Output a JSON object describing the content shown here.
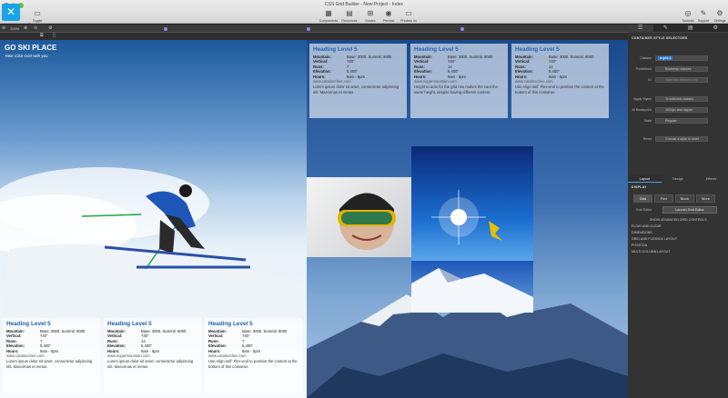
{
  "window": {
    "title": "CSS Grid Builder - New Project - Index"
  },
  "toolbar": {
    "toggle_breakpoints": "Toggle Breakpoints",
    "components": "Components",
    "resources": "Resources",
    "guides": "Guides",
    "preview": "Preview",
    "preview_on": "Preview on",
    "tutorials": "Tutorials",
    "support": "Support",
    "settings": "Settings",
    "zoom": "100%"
  },
  "breadcrumb": "Grid Box",
  "site": {
    "title": "GO SKI PLACE",
    "tagline": "Take CSS Grid with you"
  },
  "cards_top": [
    {
      "heading": "Heading Level 5",
      "rows": [
        [
          "Mountain:",
          "Base: 3000. Summit: 9000"
        ],
        [
          "Vertical:",
          "740\""
        ],
        [
          "Runs:",
          "7"
        ],
        [
          "Elevation:",
          "5,400\""
        ],
        [
          "Hours:",
          "9am - 5pm"
        ]
      ],
      "url": "www.cataloochee.com",
      "text": "Lorem ipsum dolor sit amet, consectetur adipiscing elit. Maecenas et metus."
    },
    {
      "heading": "Heading Level 5",
      "rows": [
        [
          "Mountain:",
          "Base: 3000. Summit: 9000"
        ],
        [
          "Vertical:",
          "740\""
        ],
        [
          "Runs:",
          "14"
        ],
        [
          "Elevation:",
          "5,400\""
        ],
        [
          "Hours:",
          "9am - 5pm"
        ]
      ],
      "url": "www.sugarmountain.com",
      "text": "Height to auto for the grid row makes the card the same height, despite having different content."
    },
    {
      "heading": "Heading Level 5",
      "rows": [
        [
          "Mountain:",
          "Base: 3000. Summit: 9000"
        ],
        [
          "Vertical:",
          "740\""
        ],
        [
          "Runs:",
          "14"
        ],
        [
          "Elevation:",
          "5,400\""
        ],
        [
          "Hours:",
          "9am - 5pm"
        ]
      ],
      "url": "www.cataloochee.com",
      "text": "Use Align self: Flex-end to position the content at the bottom of this container."
    }
  ],
  "cards_bottom": [
    {
      "heading": "Heading Level 5",
      "rows": [
        [
          "Mountain:",
          "Base: 3000. Summit: 9000"
        ],
        [
          "Vertical:",
          "740\""
        ],
        [
          "Runs:",
          "7"
        ],
        [
          "Elevation:",
          "5,400\""
        ],
        [
          "Hours:",
          "9am - 5pm"
        ]
      ],
      "url": "www.cataloochee.com",
      "text": "Lorem ipsum dolor sit amet, consectetur adipiscing elit. Maecenas et metus."
    },
    {
      "heading": "Heading Level 5",
      "rows": [
        [
          "Mountain:",
          "Base: 3000. Summit: 9000"
        ],
        [
          "Vertical:",
          "740\""
        ],
        [
          "Runs:",
          "14"
        ],
        [
          "Elevation:",
          "5,400\""
        ],
        [
          "Hours:",
          "9am - 5pm"
        ]
      ],
      "url": "www.sugarmountain.com",
      "text": "Lorem ipsum dolor sit amet, consectetur adipiscing elit. Maecenas et metus."
    },
    {
      "heading": "Heading Level 5",
      "rows": [
        [
          "Mountain:",
          "Base: 3000. Summit: 9000"
        ],
        [
          "Vertical:",
          "740\""
        ],
        [
          "Runs:",
          "7"
        ],
        [
          "Elevation:",
          "5,400\""
        ],
        [
          "Hours:",
          "9am - 5pm"
        ]
      ],
      "url": "www.cataloochee.com",
      "text": "Use Align self: Flex-end to position the content at the bottom of this container."
    }
  ],
  "panel": {
    "section_title": "CONTAINER STYLE SELECTORS",
    "classes_label": "Classes",
    "classes_value": "a-grid-1",
    "predefined_label": "Predefined",
    "predefined_value": "Bootstrap classes",
    "id_label": "ID",
    "id_placeholder": "Style this element only",
    "apply_label": "Apply Styles",
    "apply_value": "To selected classes",
    "breakpoint_label": "At Breakpoint",
    "breakpoint_value": "1024px and higher",
    "state_label": "State",
    "state_value": "Regular",
    "reset_label": "Reset",
    "reset_value": "Choose a style to reset",
    "tabs": [
      "Layout",
      "Design",
      "Effects"
    ],
    "display_title": "DISPLAY",
    "display_options": [
      "Grid",
      "Flex",
      "Block",
      "More"
    ],
    "grid_editor_label": "Grid Editor",
    "grid_editor_button": "Launch Grid Editor",
    "advanced": "SHOW ADVANCED GRID CONTROLS",
    "accordion": [
      "FLOAT AND CLEAR",
      "DIMENSIONS",
      "GRID AND FLEXBOX LAYOUT",
      "POSITION",
      "MULTI-COLUMN LAYOUT"
    ]
  }
}
